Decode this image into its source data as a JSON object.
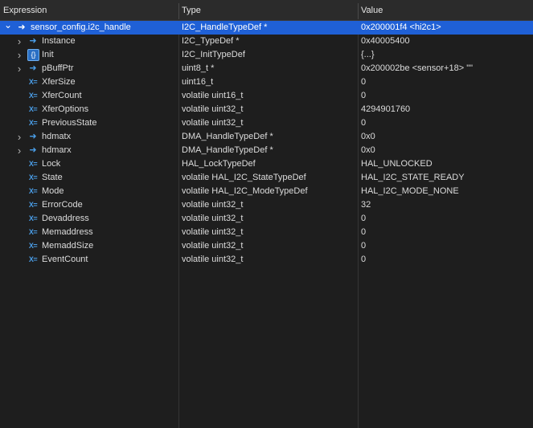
{
  "header": {
    "expression": "Expression",
    "type": "Type",
    "value": "Value"
  },
  "rows": [
    {
      "name": "sensor_config.i2c_handle",
      "type": "I2C_HandleTypeDef *",
      "value": "0x200001f4 <hi2c1>",
      "icon": "pointer-arrow-icon",
      "chevron": "expanded"
    },
    {
      "name": "Instance",
      "type": "I2C_TypeDef *",
      "value": "0x40005400",
      "icon": "pointer-arrow-icon",
      "chevron": "collapsed"
    },
    {
      "name": "Init",
      "type": "I2C_InitTypeDef",
      "value": "{...}",
      "icon": "struct-icon",
      "chevron": "collapsed"
    },
    {
      "name": "pBuffPtr",
      "type": "uint8_t *",
      "value": "0x200002be <sensor+18> \"\"",
      "icon": "pointer-arrow-icon",
      "chevron": "collapsed"
    },
    {
      "name": "XferSize",
      "type": "uint16_t",
      "value": "0",
      "icon": "variable-x-icon",
      "chevron": "none"
    },
    {
      "name": "XferCount",
      "type": "volatile uint16_t",
      "value": "0",
      "icon": "variable-x-icon",
      "chevron": "none"
    },
    {
      "name": "XferOptions",
      "type": "volatile uint32_t",
      "value": "4294901760",
      "icon": "variable-x-icon",
      "chevron": "none"
    },
    {
      "name": "PreviousState",
      "type": "volatile uint32_t",
      "value": "0",
      "icon": "variable-x-icon",
      "chevron": "none"
    },
    {
      "name": "hdmatx",
      "type": "DMA_HandleTypeDef *",
      "value": "0x0",
      "icon": "pointer-arrow-icon",
      "chevron": "collapsed"
    },
    {
      "name": "hdmarx",
      "type": "DMA_HandleTypeDef *",
      "value": "0x0",
      "icon": "pointer-arrow-icon",
      "chevron": "collapsed"
    },
    {
      "name": "Lock",
      "type": "HAL_LockTypeDef",
      "value": "HAL_UNLOCKED",
      "icon": "variable-x-icon",
      "chevron": "none"
    },
    {
      "name": "State",
      "type": "volatile HAL_I2C_StateTypeDef",
      "value": "HAL_I2C_STATE_READY",
      "icon": "variable-x-icon",
      "chevron": "none"
    },
    {
      "name": "Mode",
      "type": "volatile HAL_I2C_ModeTypeDef",
      "value": "HAL_I2C_MODE_NONE",
      "icon": "variable-x-icon",
      "chevron": "none"
    },
    {
      "name": "ErrorCode",
      "type": "volatile uint32_t",
      "value": "32",
      "icon": "variable-x-icon",
      "chevron": "none"
    },
    {
      "name": "Devaddress",
      "type": "volatile uint32_t",
      "value": "0",
      "icon": "variable-x-icon",
      "chevron": "none"
    },
    {
      "name": "Memaddress",
      "type": "volatile uint32_t",
      "value": "0",
      "icon": "variable-x-icon",
      "chevron": "none"
    },
    {
      "name": "MemaddSize",
      "type": "volatile uint32_t",
      "value": "0",
      "icon": "variable-x-icon",
      "chevron": "none"
    },
    {
      "name": "EventCount",
      "type": "volatile uint32_t",
      "value": "0",
      "icon": "variable-x-icon",
      "chevron": "none"
    }
  ],
  "selected_row": 0,
  "colors": {
    "selection": "#1f60d6",
    "icon_accent": "#4a9ee8",
    "background": "#1e1e1e"
  }
}
